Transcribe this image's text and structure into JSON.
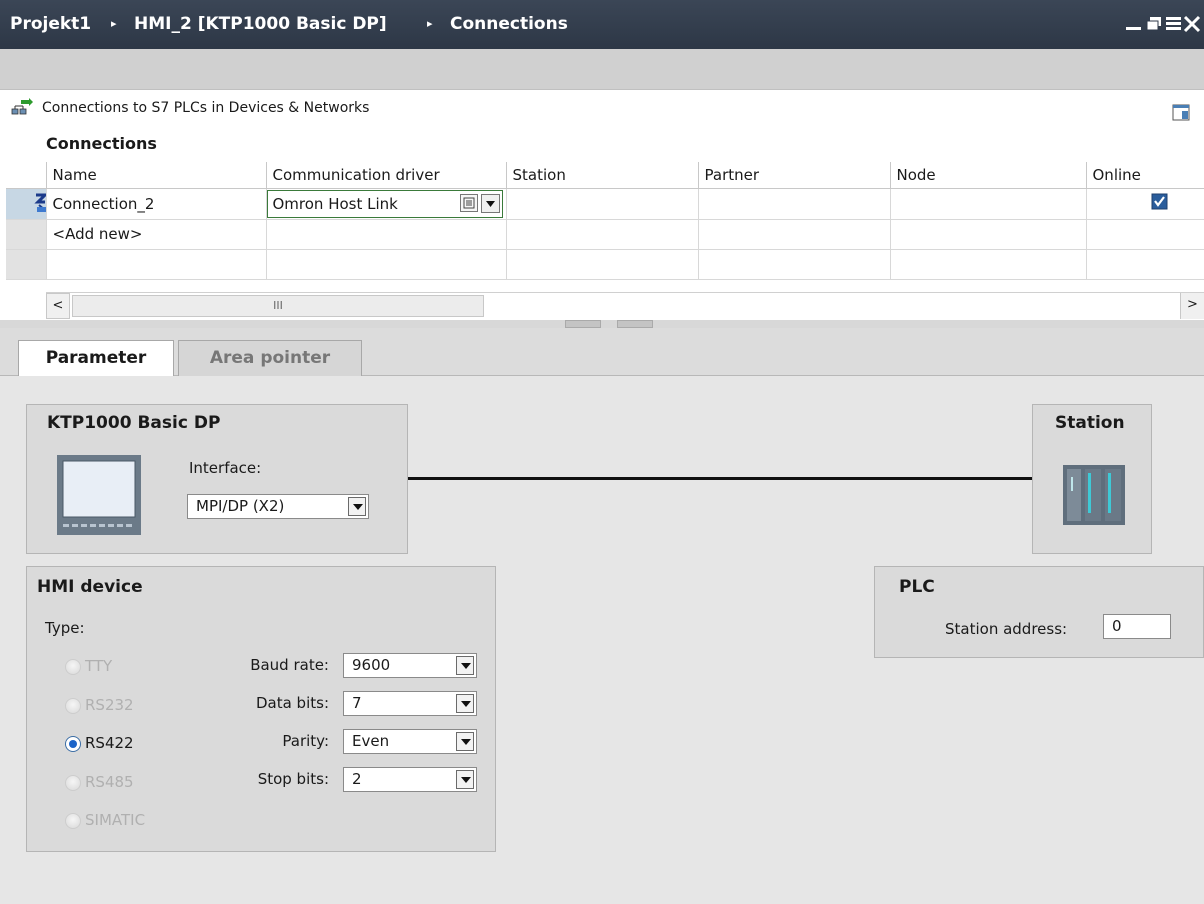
{
  "titlebar": {
    "crumbs": [
      "Projekt1",
      "HMI_2 [KTP1000 Basic DP]",
      "Connections"
    ],
    "separator": "▸"
  },
  "info": {
    "text": "Connections to S7 PLCs in Devices & Networks"
  },
  "connections": {
    "title": "Connections",
    "columns": [
      "Name",
      "Communication driver",
      "Station",
      "Partner",
      "Node",
      "Online"
    ],
    "rows": [
      {
        "name": "Connection_2",
        "driver": "Omron Host Link",
        "station": "",
        "partner": "",
        "node": "",
        "online": true
      }
    ],
    "add_new": "<Add new>"
  },
  "scroll": {
    "thumb_grip": "III"
  },
  "tabs": [
    {
      "label": "Parameter",
      "active": true
    },
    {
      "label": "Area pointer",
      "active": false
    }
  ],
  "device_panel": {
    "title": "KTP1000 Basic DP",
    "interface_label": "Interface:",
    "interface_value": "MPI/DP (X2)"
  },
  "station_panel": {
    "title": "Station"
  },
  "hmi_panel": {
    "title": "HMI device",
    "type_label": "Type:",
    "types": [
      {
        "label": "TTY",
        "selected": false,
        "enabled": false
      },
      {
        "label": "RS232",
        "selected": false,
        "enabled": false
      },
      {
        "label": "RS422",
        "selected": true,
        "enabled": true
      },
      {
        "label": "RS485",
        "selected": false,
        "enabled": false
      },
      {
        "label": "SIMATIC",
        "selected": false,
        "enabled": false
      }
    ],
    "baud_label": "Baud rate:",
    "baud_value": "9600",
    "databits_label": "Data bits:",
    "databits_value": "7",
    "parity_label": "Parity:",
    "parity_value": "Even",
    "stopbits_label": "Stop bits:",
    "stopbits_value": "2"
  },
  "plc_panel": {
    "title": "PLC",
    "station_address_label": "Station address:",
    "station_address_value": "0"
  },
  "colors": {
    "titlebar": "#2f3a4a",
    "accent_blue": "#1c64c8",
    "edit_border": "#3a7a3a"
  }
}
